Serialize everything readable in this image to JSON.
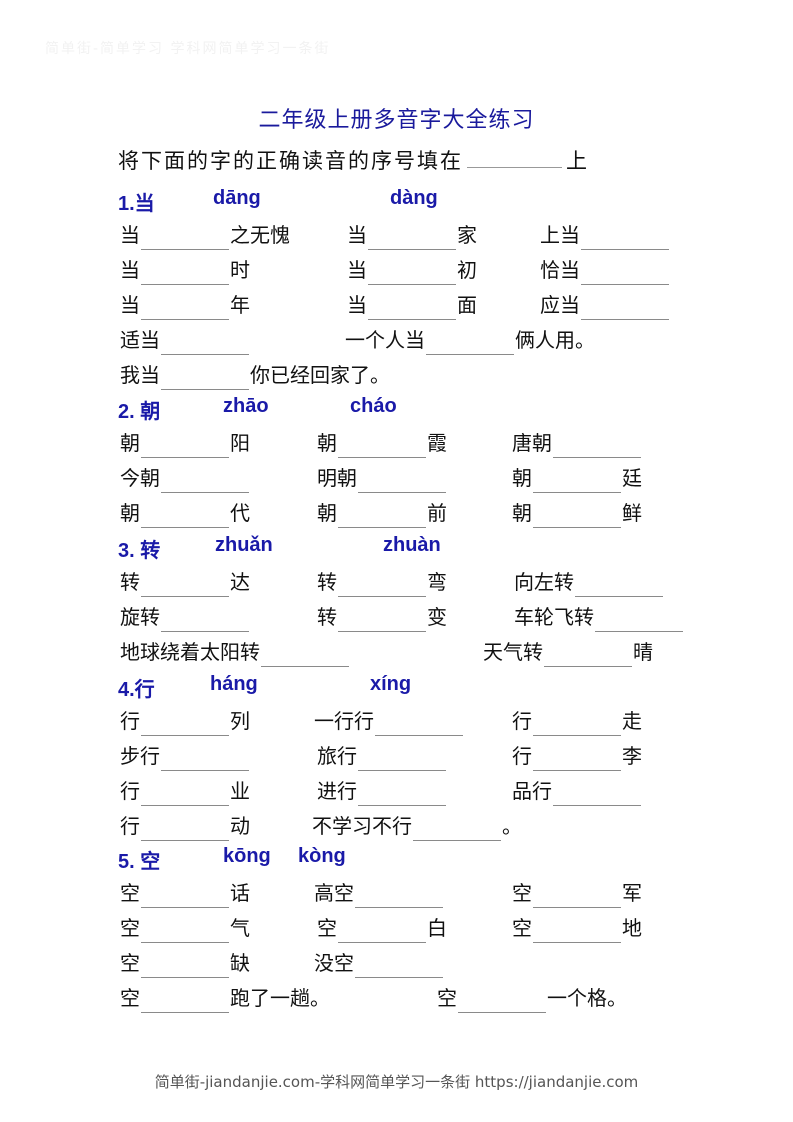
{
  "watermark": "简单街-简单学习 学科网简单学习一条街",
  "title": "二年级上册多音字大全练习",
  "instruction": {
    "before": "将下面的字的正确读音的序号填在",
    "after": "上"
  },
  "sections": [
    {
      "number": "1.当",
      "pinyin": [
        "dāng",
        "dàng"
      ],
      "rows": [
        [
          {
            "pre": "当",
            "post": "之无愧"
          },
          {
            "pre": "当",
            "post": "家"
          },
          {
            "pre": "上当",
            "post": ""
          }
        ],
        [
          {
            "pre": "当",
            "post": "时"
          },
          {
            "pre": "当",
            "post": "初"
          },
          {
            "pre": "恰当",
            "post": ""
          }
        ],
        [
          {
            "pre": "当",
            "post": "年"
          },
          {
            "pre": "当",
            "post": "面"
          },
          {
            "pre": "应当",
            "post": ""
          }
        ],
        [
          {
            "pre": "适当",
            "post": ""
          },
          {
            "pre": "一个人当",
            "post": "俩人用。"
          }
        ],
        [
          {
            "pre": "我当",
            "post": "你已经回家了。"
          }
        ]
      ]
    },
    {
      "number": "2. 朝",
      "pinyin": [
        "zhāo",
        "cháo"
      ],
      "rows": [
        [
          {
            "pre": "朝",
            "post": "阳"
          },
          {
            "pre": "朝",
            "post": "霞"
          },
          {
            "pre": "唐朝",
            "post": ""
          }
        ],
        [
          {
            "pre": "今朝",
            "post": ""
          },
          {
            "pre": "明朝",
            "post": ""
          },
          {
            "pre": "朝",
            "post": "廷"
          }
        ],
        [
          {
            "pre": "朝",
            "post": "代"
          },
          {
            "pre": "朝",
            "post": "前"
          },
          {
            "pre": "朝",
            "post": "鲜"
          }
        ]
      ]
    },
    {
      "number": "3. 转",
      "pinyin": [
        "zhuǎn",
        "zhuàn"
      ],
      "rows": [
        [
          {
            "pre": "转",
            "post": "达"
          },
          {
            "pre": "转",
            "post": "弯"
          },
          {
            "pre": "向左转",
            "post": ""
          }
        ],
        [
          {
            "pre": "旋转",
            "post": ""
          },
          {
            "pre": "转",
            "post": "变"
          },
          {
            "pre": "车轮飞转",
            "post": ""
          }
        ],
        [
          {
            "pre": "地球绕着太阳转",
            "post": ""
          },
          {
            "pre": "天气转",
            "post": "晴"
          }
        ]
      ]
    },
    {
      "number": "4.行",
      "pinyin": [
        "háng",
        "xíng"
      ],
      "rows": [
        [
          {
            "pre": "行",
            "post": "列"
          },
          {
            "pre": "一行行",
            "post": ""
          },
          {
            "pre": "行",
            "post": "走"
          }
        ],
        [
          {
            "pre": "步行",
            "post": ""
          },
          {
            "pre": "旅行",
            "post": ""
          },
          {
            "pre": "行",
            "post": "李"
          }
        ],
        [
          {
            "pre": "行",
            "post": "业"
          },
          {
            "pre": "进行",
            "post": ""
          },
          {
            "pre": "品行",
            "post": ""
          }
        ],
        [
          {
            "pre": "行",
            "post": "动"
          },
          {
            "pre": "不学习不行",
            "post": "。"
          }
        ]
      ]
    },
    {
      "number": "5. 空",
      "pinyin": [
        "kōng",
        "kòng"
      ],
      "rows": [
        [
          {
            "pre": "空",
            "post": "话"
          },
          {
            "pre": "高空",
            "post": ""
          },
          {
            "pre": "空",
            "post": "军"
          }
        ],
        [
          {
            "pre": "空",
            "post": "气"
          },
          {
            "pre": "空",
            "post": "白"
          },
          {
            "pre": "空",
            "post": "地"
          }
        ],
        [
          {
            "pre": "空",
            "post": "缺"
          },
          {
            "pre": "没空",
            "post": ""
          }
        ],
        [
          {
            "pre": "空",
            "post": "跑了一趟。"
          },
          {
            "pre": "空",
            "post": "一个格。"
          }
        ]
      ]
    }
  ],
  "footer": "简单街-jiandanjie.com-学科网简单学习一条街 https://jiandanjie.com"
}
